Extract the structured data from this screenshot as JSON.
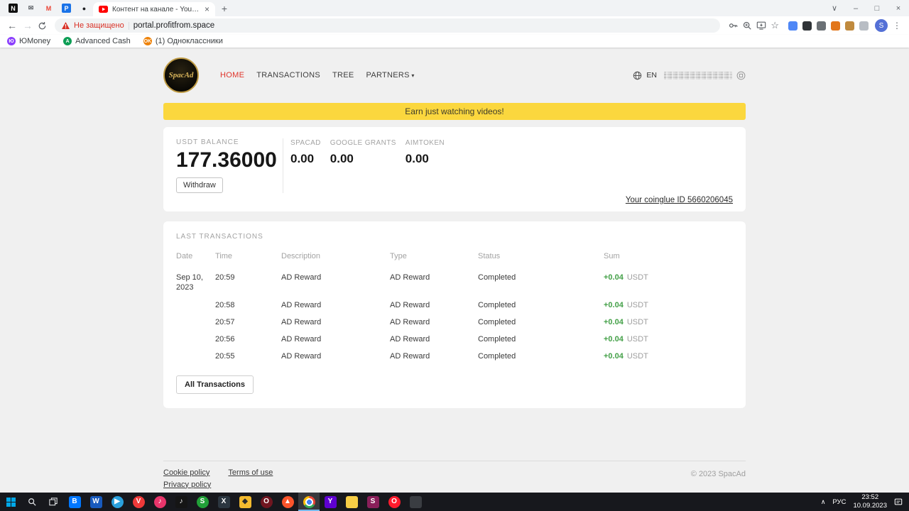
{
  "browser": {
    "pinned_tabs": [
      {
        "name": "notion-tab",
        "glyph": "N",
        "fg": "#ffffff",
        "bg": "#111111"
      },
      {
        "name": "mail-tab",
        "glyph": "✉",
        "fg": "#5f6368",
        "bg": ""
      },
      {
        "name": "gmail-tab",
        "glyph": "M",
        "fg": "#ea4335",
        "bg": ""
      },
      {
        "name": "plesk-tab",
        "glyph": "P",
        "fg": "#ffffff",
        "bg": "#1a73e8"
      },
      {
        "name": "dark-site-tab",
        "glyph": "●",
        "fg": "#202124",
        "bg": ""
      }
    ],
    "active_tab": {
      "title": "Контент на канале - YouTube St...",
      "icon": "youtube-icon"
    },
    "address": {
      "security_label": "Не защищено",
      "url": "portal.profitfrom.space"
    },
    "extensions": [
      {
        "name": "extension-translate",
        "color": "#4f87f6"
      },
      {
        "name": "extension-grid",
        "color": "#2f3337"
      },
      {
        "name": "extension-shield",
        "color": "#6b7075"
      },
      {
        "name": "metamask-fox",
        "color": "#e2761b"
      },
      {
        "name": "extension-wallet",
        "color": "#c08a3e"
      },
      {
        "name": "extension-notes",
        "color": "#b8bdc4"
      }
    ],
    "bookmarks": [
      {
        "label": "ЮMoney",
        "icon": "yoomoney-icon",
        "color": "#8b3ffd",
        "glyph": "Ю"
      },
      {
        "label": "Advanced Cash",
        "icon": "advcash-icon",
        "color": "#0d9e55",
        "glyph": "A"
      },
      {
        "label": "(1) Одноклассники",
        "icon": "ok-icon",
        "color": "#ee8208",
        "glyph": "OK"
      }
    ],
    "profile_initial": "S"
  },
  "site": {
    "logo_text": "SpacAd",
    "nav": [
      {
        "label": "HOME",
        "active": true
      },
      {
        "label": "TRANSACTIONS"
      },
      {
        "label": "TREE"
      },
      {
        "label": "PARTNERS",
        "dropdown": true
      }
    ],
    "language": "EN",
    "banner_text": "Earn just watching videos!",
    "balance": {
      "label": "USDT BALANCE",
      "value": "177.36000",
      "withdraw_label": "Withdraw",
      "tokens": [
        {
          "label": "SPACAD",
          "value": "0.00"
        },
        {
          "label": "GOOGLE GRANTS",
          "value": "0.00"
        },
        {
          "label": "AIMTOKEN",
          "value": "0.00"
        }
      ]
    },
    "coinglue_link": "Your coinglue ID 5660206045",
    "transactions": {
      "title": "LAST TRANSACTIONS",
      "columns": [
        "Date",
        "Time",
        "Description",
        "Type",
        "Status",
        "Sum"
      ],
      "rows": [
        {
          "date": "Sep 10, 2023",
          "time": "20:59",
          "description": "AD Reward",
          "type": "AD Reward",
          "status": "Completed",
          "amount": "+0.04",
          "currency": "USDT"
        },
        {
          "date": "",
          "time": "20:58",
          "description": "AD Reward",
          "type": "AD Reward",
          "status": "Completed",
          "amount": "+0.04",
          "currency": "USDT"
        },
        {
          "date": "",
          "time": "20:57",
          "description": "AD Reward",
          "type": "AD Reward",
          "status": "Completed",
          "amount": "+0.04",
          "currency": "USDT"
        },
        {
          "date": "",
          "time": "20:56",
          "description": "AD Reward",
          "type": "AD Reward",
          "status": "Completed",
          "amount": "+0.04",
          "currency": "USDT"
        },
        {
          "date": "",
          "time": "20:55",
          "description": "AD Reward",
          "type": "AD Reward",
          "status": "Completed",
          "amount": "+0.04",
          "currency": "USDT"
        }
      ],
      "all_button_label": "All Transactions"
    },
    "footer": {
      "links": [
        "Cookie policy",
        "Terms of use",
        "Privacy policy"
      ],
      "copyright": "© 2023 SpacAd"
    }
  },
  "taskbar": {
    "language": "РУС",
    "time": "23:52",
    "date": "10.09.2023",
    "apps": [
      {
        "name": "vk",
        "color": "#0077ff",
        "glyph": "B"
      },
      {
        "name": "word",
        "color": "#185abd",
        "glyph": "W"
      },
      {
        "name": "telegram",
        "color": "#2aa0dc",
        "glyph": "▶",
        "round": true
      },
      {
        "name": "vivaldi",
        "color": "#ef3939",
        "glyph": "V",
        "round": true
      },
      {
        "name": "music",
        "color": "#e9356b",
        "glyph": "♪",
        "round": true
      },
      {
        "name": "tiktok",
        "color": "#151515",
        "glyph": "♪"
      },
      {
        "name": "sber",
        "color": "#21a038",
        "glyph": "S",
        "round": true
      },
      {
        "name": "onexbet",
        "color": "#2b3640",
        "glyph": "X"
      },
      {
        "name": "binance",
        "color": "#f3ba2f",
        "glyph": "◆",
        "fg": "#2b2b2b"
      },
      {
        "name": "operagx",
        "color": "#701620",
        "glyph": "O",
        "round": true
      },
      {
        "name": "brave",
        "color": "#fb542b",
        "glyph": "▲",
        "round": true
      },
      {
        "name": "chrome",
        "active": true,
        "round": true
      },
      {
        "name": "yahoo",
        "color": "#5f01d1",
        "glyph": "Y"
      },
      {
        "name": "explorer",
        "color": "#f8ce46",
        "glyph": ""
      },
      {
        "name": "skrill",
        "color": "#8a1f5a",
        "glyph": "S"
      },
      {
        "name": "opera",
        "color": "#ff1b2d",
        "glyph": "O",
        "round": true
      },
      {
        "name": "phone-link",
        "color": "#3a3d42",
        "glyph": ""
      }
    ]
  }
}
